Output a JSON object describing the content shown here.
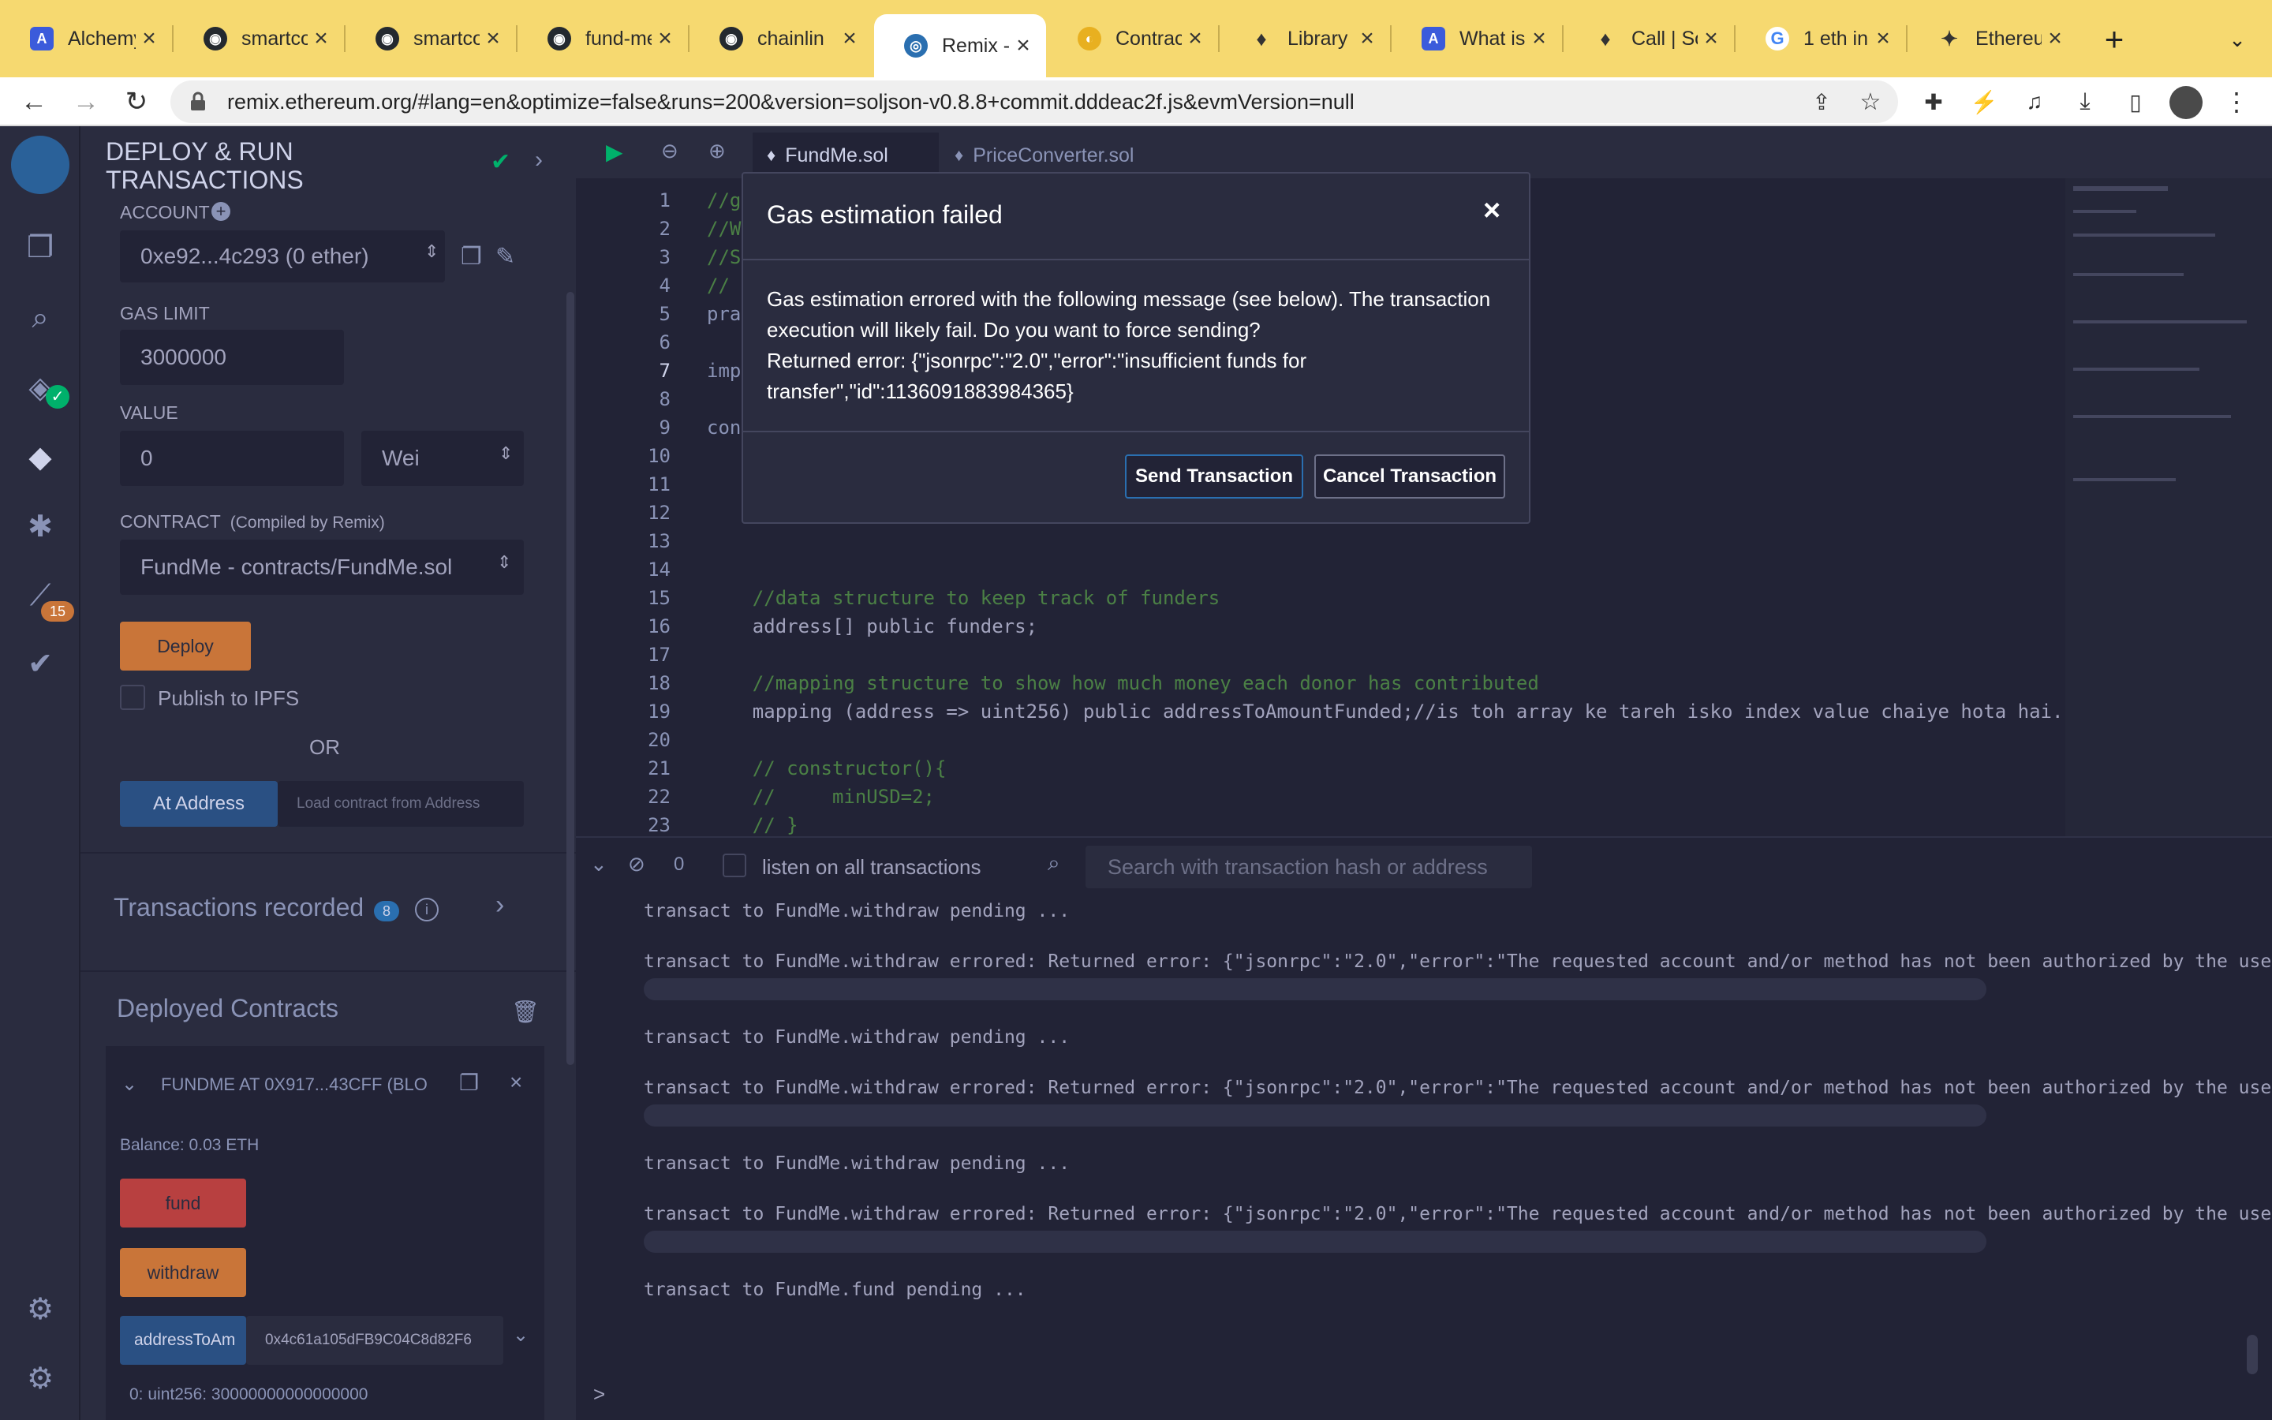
{
  "browser": {
    "tabs": [
      {
        "title": "Alchemy",
        "icon": "alchemy-icon"
      },
      {
        "title": "smartco",
        "icon": "github-icon"
      },
      {
        "title": "smartco",
        "icon": "github-icon"
      },
      {
        "title": "fund-me",
        "icon": "github-icon"
      },
      {
        "title": "chainlin",
        "icon": "github-icon"
      },
      {
        "title": "Remix -",
        "icon": "remix-icon"
      },
      {
        "title": "Contrac",
        "icon": "chainlink-icon"
      },
      {
        "title": "Library",
        "icon": "solidity-icon"
      },
      {
        "title": "What is",
        "icon": "alchemy-icon"
      },
      {
        "title": "Call | So",
        "icon": "solidity-icon"
      },
      {
        "title": "1 eth in",
        "icon": "google-icon"
      },
      {
        "title": "Ethereu",
        "icon": "ethereum-icon"
      }
    ],
    "active_tab": 5,
    "new_tab_label": "+",
    "url": "remix.ethereum.org/#lang=en&optimize=false&runs=200&version=soljson-v0.8.8+commit.dddeac2f.js&evmVersion=null"
  },
  "sidebar": {
    "title_line1": "DEPLOY & RUN",
    "title_line2": "TRANSACTIONS",
    "account_label": "ACCOUNT",
    "account_value": "0xe92...4c293 (0 ether)",
    "gas_limit_label": "GAS LIMIT",
    "gas_limit_value": "3000000",
    "value_label": "VALUE",
    "value_amount": "0",
    "value_unit": "Wei",
    "contract_label": "CONTRACT",
    "contract_hint": "(Compiled by Remix)",
    "contract_value": "FundMe - contracts/FundMe.sol",
    "deploy_label": "Deploy",
    "publish_ipfs_label": "Publish to IPFS",
    "or_label": "OR",
    "at_address_label": "At Address",
    "load_contract_placeholder": "Load contract from Address",
    "transactions_recorded_label": "Transactions recorded",
    "transactions_recorded_count": "8",
    "deployed_contracts_label": "Deployed Contracts",
    "instance_name": "FUNDME AT 0X917...43CFF (BLO",
    "balance": "Balance: 0.03 ETH",
    "fund_label": "fund",
    "withdraw_label": "withdraw",
    "address_to_amount_label": "addressToAm",
    "address_to_amount_input": "0x4c61a105dFB9C04C8d82F6",
    "address_to_amount_result": "0: uint256: 30000000000000000",
    "plugin_badge": "15"
  },
  "editor": {
    "tabs": [
      "FundMe.sol",
      "PriceConverter.sol"
    ],
    "lines": [
      {
        "n": "1",
        "text": "//g",
        "color": "#4b8045"
      },
      {
        "n": "2",
        "text": "//W",
        "color": "#4b8045"
      },
      {
        "n": "3",
        "text": "//S",
        "color": "#4b8045"
      },
      {
        "n": "4",
        "text": "//",
        "color": "#4b8045"
      },
      {
        "n": "5",
        "text": "pra",
        "color": "#8a93b6"
      },
      {
        "n": "6",
        "text": "",
        "color": "#a2a3bd"
      },
      {
        "n": "7",
        "text": "imp",
        "color": "#8a93b6"
      },
      {
        "n": "8",
        "text": "",
        "color": "#a2a3bd"
      },
      {
        "n": "9",
        "text": "con",
        "color": "#8a93b6"
      },
      {
        "n": "10",
        "text": "",
        "color": "#a2a3bd"
      },
      {
        "n": "11",
        "text": "",
        "color": "#a2a3bd"
      },
      {
        "n": "12",
        "text": "",
        "color": "#a2a3bd"
      },
      {
        "n": "13",
        "text": "",
        "color": "#a2a3bd"
      },
      {
        "n": "14",
        "text": "",
        "color": "#a2a3bd"
      },
      {
        "n": "15",
        "text": "    //data structure to keep track of funders",
        "color": "#4b8045"
      },
      {
        "n": "16",
        "text": "    address[] public funders;",
        "color": "#a2a3bd"
      },
      {
        "n": "17",
        "text": "",
        "color": "#a2a3bd"
      },
      {
        "n": "18",
        "text": "    //mapping structure to show how much money each donor has contributed",
        "color": "#4b8045"
      },
      {
        "n": "19",
        "text": "    mapping (address => uint256) public addressToAmountFunded;//is toh array ke tareh isko index value chaiye hota hai.",
        "color": "#a2a3bd"
      },
      {
        "n": "20",
        "text": "",
        "color": "#a2a3bd"
      },
      {
        "n": "21",
        "text": "    // constructor(){",
        "color": "#4b8045"
      },
      {
        "n": "22",
        "text": "    //     minUSD=2;",
        "color": "#4b8045"
      },
      {
        "n": "23",
        "text": "    // }",
        "color": "#4b8045"
      }
    ]
  },
  "terminal": {
    "pending_count": "0",
    "listen_label": "listen on all transactions",
    "search_placeholder": "Search with transaction hash or address",
    "logs": [
      "transact to FundMe.withdraw pending ...",
      "transact to FundMe.withdraw errored: Returned error: {\"jsonrpc\":\"2.0\",\"error\":\"The requested account and/or method has not been authorized by the user.'",
      "transact to FundMe.withdraw pending ...",
      "transact to FundMe.withdraw errored: Returned error: {\"jsonrpc\":\"2.0\",\"error\":\"The requested account and/or method has not been authorized by the user.'",
      "transact to FundMe.withdraw pending ...",
      "transact to FundMe.withdraw errored: Returned error: {\"jsonrpc\":\"2.0\",\"error\":\"The requested account and/or method has not been authorized by the user.'",
      "transact to FundMe.fund pending ..."
    ],
    "prompt": ">"
  },
  "modal": {
    "title": "Gas estimation failed",
    "close": "×",
    "body_line1": "Gas estimation errored with the following message (see below). The transaction",
    "body_line2": "execution will likely fail. Do you want to force sending?",
    "body_line3": "Returned error: {\"jsonrpc\":\"2.0\",\"error\":\"insufficient funds for",
    "body_line4": "transfer\",\"id\":1136091883984365}",
    "send_label": "Send Transaction",
    "cancel_label": "Cancel Transaction"
  },
  "colors": {
    "remix_bg": "#222336",
    "panel_bg": "#2a2c3f",
    "deploy_btn": "#c97539",
    "fund_btn": "#b84040",
    "withdraw_btn": "#c97539",
    "call_btn": "#2a5083",
    "tab_strip": "#f6d970"
  }
}
